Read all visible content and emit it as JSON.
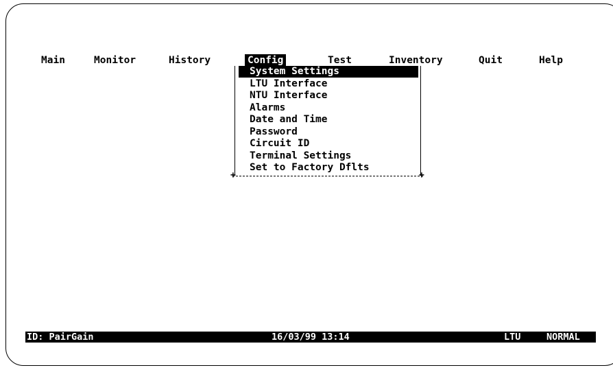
{
  "menu_bar": {
    "items": [
      {
        "label": "Main"
      },
      {
        "label": "Monitor"
      },
      {
        "label": "History"
      },
      {
        "label": "Config"
      },
      {
        "label": "Test"
      },
      {
        "label": "Inventory"
      },
      {
        "label": "Quit"
      },
      {
        "label": "Help"
      }
    ],
    "active_item": "Config"
  },
  "config_menu": {
    "items": [
      {
        "label": "System Settings"
      },
      {
        "label": "LTU Interface"
      },
      {
        "label": "NTU Interface"
      },
      {
        "label": "Alarms"
      },
      {
        "label": "Date and Time"
      },
      {
        "label": "Password"
      },
      {
        "label": "Circuit ID"
      },
      {
        "label": "Terminal Settings"
      },
      {
        "label": "Set to Factory Dflts"
      }
    ],
    "highlighted_item": "System Settings"
  },
  "status_bar": {
    "id_text": "ID: PairGain",
    "datetime": "16/03/99 13:14",
    "unit": "LTU",
    "mode": "NORMAL"
  },
  "colors": {
    "background": "#ffffff",
    "foreground": "#000000",
    "highlight_bg": "#000000",
    "highlight_fg": "#ffffff"
  }
}
